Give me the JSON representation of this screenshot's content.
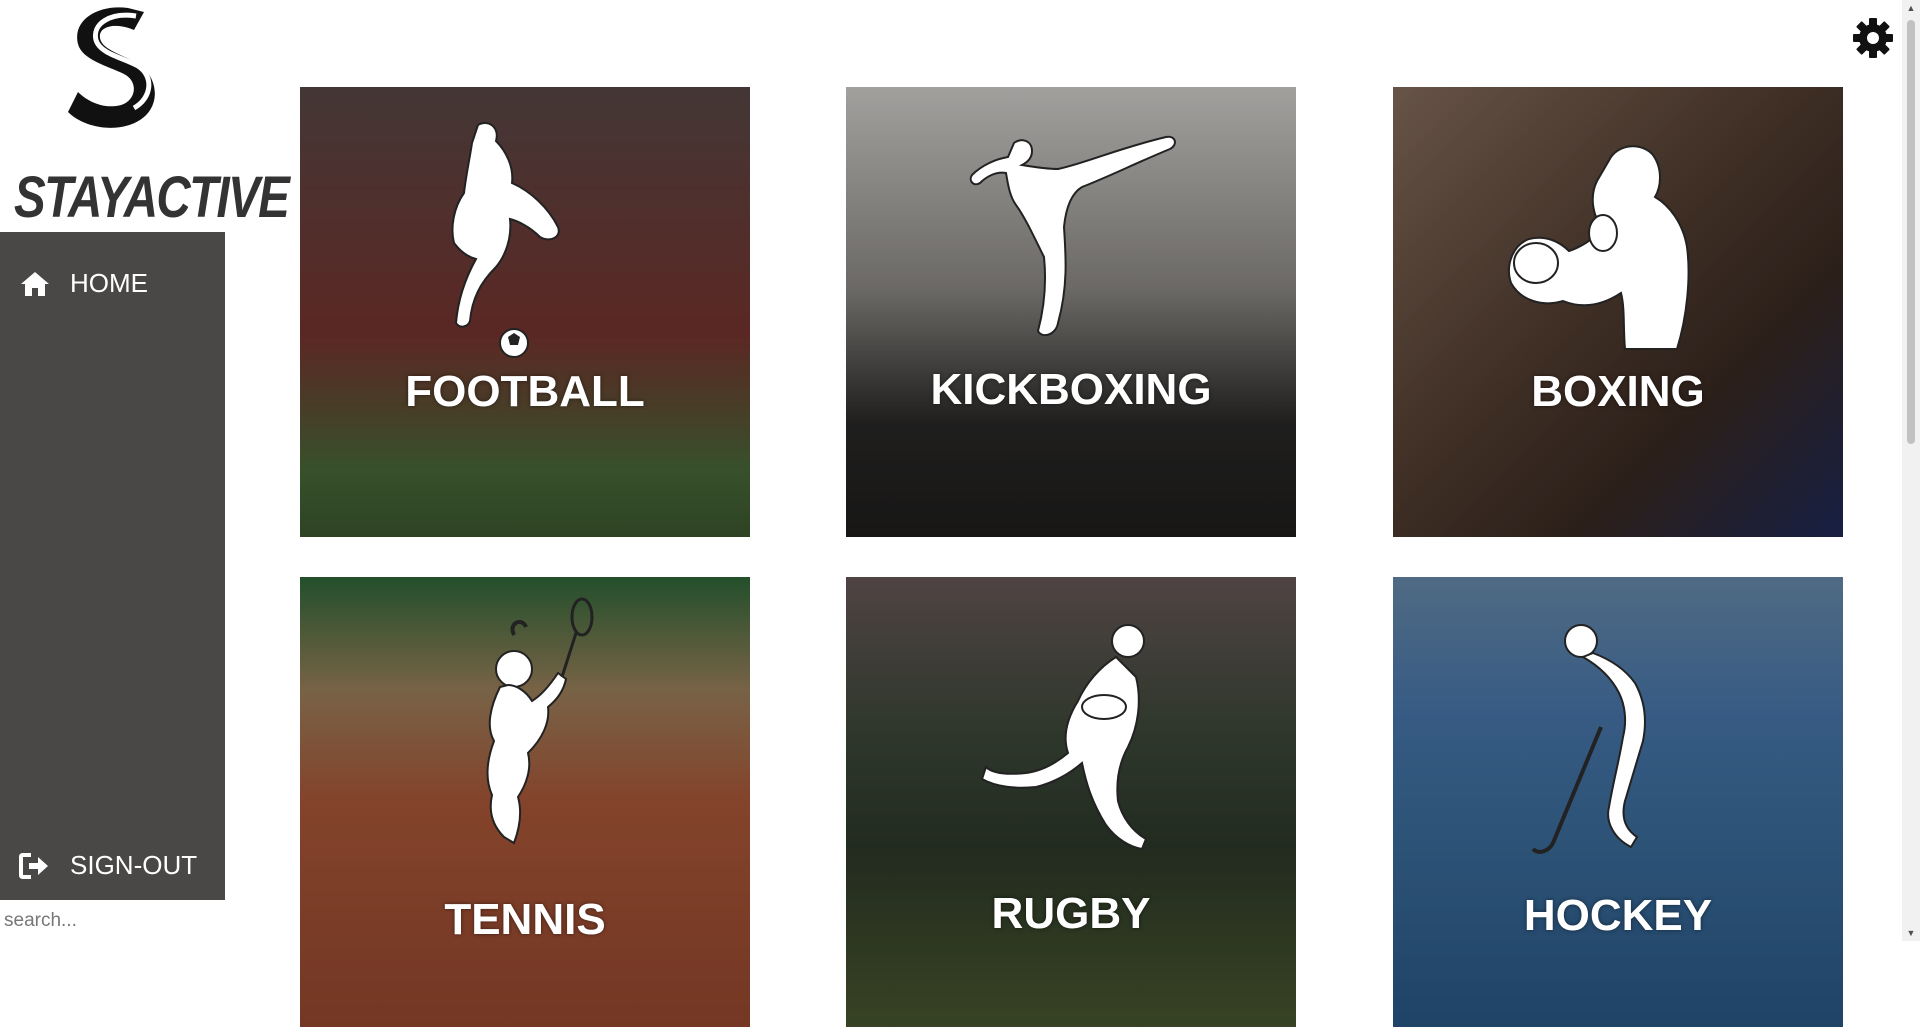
{
  "brand": {
    "logo_text": "STAYACTIVE"
  },
  "sidebar": {
    "home": {
      "label": "HOME",
      "icon": "home-icon"
    },
    "signout": {
      "label": "SIGN-OUT",
      "icon": "sign-out-icon"
    }
  },
  "search": {
    "placeholder": "search..."
  },
  "settings": {
    "icon": "gear-icon"
  },
  "colors": {
    "sidebar": "#494847",
    "tile_text": "#ffffff",
    "logo": "#333333"
  },
  "sports": [
    {
      "label": "FOOTBALL",
      "icon": "football-player-icon",
      "bg": "#6b4b45"
    },
    {
      "label": "KICKBOXING",
      "icon": "kickboxer-icon",
      "bg": "#3c3a39"
    },
    {
      "label": "BOXING",
      "icon": "boxer-icon",
      "bg": "#5a4436"
    },
    {
      "label": "TENNIS",
      "icon": "tennis-player-icon",
      "bg": "#8a4a35"
    },
    {
      "label": "RUGBY",
      "icon": "rugby-player-icon",
      "bg": "#3e4a3a"
    },
    {
      "label": "HOCKEY",
      "icon": "hockey-player-icon",
      "bg": "#3b6e9e"
    }
  ]
}
